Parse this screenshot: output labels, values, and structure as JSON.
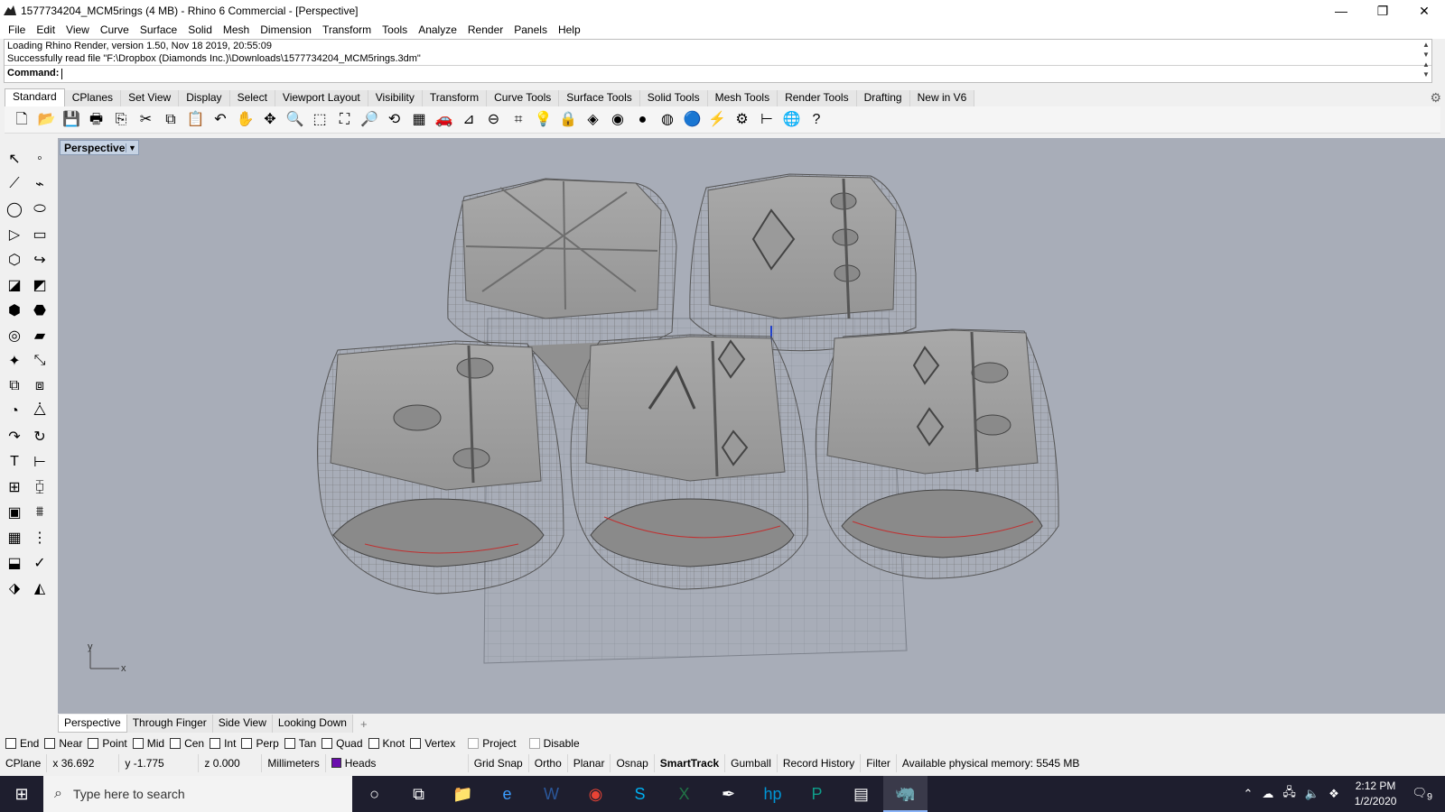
{
  "window": {
    "title": "1577734204_MCM5rings (4 MB) - Rhino 6 Commercial - [Perspective]",
    "minimize": "—",
    "restore": "❐",
    "close": "✕"
  },
  "menu": [
    "File",
    "Edit",
    "View",
    "Curve",
    "Surface",
    "Solid",
    "Mesh",
    "Dimension",
    "Transform",
    "Tools",
    "Analyze",
    "Render",
    "Panels",
    "Help"
  ],
  "command_history": [
    "Loading Rhino Render, version 1.50, Nov 18 2019, 20:55:09",
    "Successfully read file \"F:\\Dropbox (Diamonds Inc.)\\Downloads\\1577734204_MCM5rings.3dm\""
  ],
  "command_prompt": "Command:",
  "toolbar_tabs": [
    "Standard",
    "CPlanes",
    "Set View",
    "Display",
    "Select",
    "Viewport Layout",
    "Visibility",
    "Transform",
    "Curve Tools",
    "Surface Tools",
    "Solid Tools",
    "Mesh Tools",
    "Render Tools",
    "Drafting",
    "New in V6"
  ],
  "toolbar_icons": [
    {
      "icon": "new-file",
      "glyph": "🗋"
    },
    {
      "icon": "open-folder",
      "glyph": "📂"
    },
    {
      "icon": "save",
      "glyph": "💾"
    },
    {
      "icon": "print",
      "glyph": "🖶"
    },
    {
      "icon": "import",
      "glyph": "⎘"
    },
    {
      "icon": "cut",
      "glyph": "✂"
    },
    {
      "icon": "copy",
      "glyph": "⧉"
    },
    {
      "icon": "paste",
      "glyph": "📋"
    },
    {
      "icon": "undo",
      "glyph": "↶"
    },
    {
      "icon": "pan-hand",
      "glyph": "✋"
    },
    {
      "icon": "rotate-view",
      "glyph": "✥"
    },
    {
      "icon": "zoom",
      "glyph": "🔍"
    },
    {
      "icon": "zoom-window",
      "glyph": "⬚"
    },
    {
      "icon": "zoom-extents",
      "glyph": "⛶"
    },
    {
      "icon": "zoom-selected",
      "glyph": "🔎"
    },
    {
      "icon": "rotate-camera",
      "glyph": "⟲"
    },
    {
      "icon": "four-viewports",
      "glyph": "▦"
    },
    {
      "icon": "car-view",
      "glyph": "🚗"
    },
    {
      "icon": "construction-plane",
      "glyph": "⊿"
    },
    {
      "icon": "select-filter",
      "glyph": "⊖"
    },
    {
      "icon": "osnap",
      "glyph": "⌗"
    },
    {
      "icon": "light-bulb",
      "glyph": "💡"
    },
    {
      "icon": "lock",
      "glyph": "🔒"
    },
    {
      "icon": "layer",
      "glyph": "◈"
    },
    {
      "icon": "color-wheel",
      "glyph": "◉"
    },
    {
      "icon": "render-sphere",
      "glyph": "●"
    },
    {
      "icon": "material-sphere",
      "glyph": "◍"
    },
    {
      "icon": "render-blue",
      "glyph": "🔵"
    },
    {
      "icon": "drafting-lamp",
      "glyph": "⚡"
    },
    {
      "icon": "options-gear",
      "glyph": "⚙"
    },
    {
      "icon": "dimension",
      "glyph": "⊢"
    },
    {
      "icon": "globe",
      "glyph": "🌐"
    },
    {
      "icon": "help",
      "glyph": "?"
    }
  ],
  "left_tools": [
    [
      "select-arrow",
      "point"
    ],
    [
      "polyline",
      "curve-tools"
    ],
    [
      "circle",
      "ellipse"
    ],
    [
      "polygon",
      "rectangle"
    ],
    [
      "arc",
      "fillet"
    ],
    [
      "surface-corner",
      "surface-tools"
    ],
    [
      "solid-box",
      "solid-boolean"
    ],
    [
      "extrude",
      "mesh"
    ],
    [
      "transform-move",
      "scale"
    ],
    [
      "array",
      "align"
    ],
    [
      "group",
      "block"
    ],
    [
      "curve-from-object",
      "offset"
    ],
    [
      "text",
      "dimension"
    ],
    [
      "layout",
      "detail"
    ],
    [
      "render-box",
      "cage"
    ],
    [
      "grid-array",
      "analyze"
    ],
    [
      "shell",
      "check"
    ],
    [
      "paint",
      "clipping"
    ]
  ],
  "viewport": {
    "name": "Perspective",
    "axis_x": "x",
    "axis_y": "y",
    "bg_color": "#a8adb8"
  },
  "view_tabs": [
    "Perspective",
    "Through Finger",
    "Side View",
    "Looking Down"
  ],
  "osnap": [
    "End",
    "Near",
    "Point",
    "Mid",
    "Cen",
    "Int",
    "Perp",
    "Tan",
    "Quad",
    "Knot",
    "Vertex"
  ],
  "osnap_extra": [
    "Project",
    "Disable"
  ],
  "status": {
    "cplane": "CPlane",
    "x": "x 36.692",
    "y": "y -1.775",
    "z": "z 0.000",
    "units": "Millimeters",
    "layer": "Heads",
    "layer_color": "#6a0dad",
    "grid_snap": "Grid Snap",
    "ortho": "Ortho",
    "planar": "Planar",
    "osnap": "Osnap",
    "smarttrack": "SmartTrack",
    "gumball": "Gumball",
    "record_history": "Record History",
    "filter": "Filter",
    "memory": "Available physical memory: 5545 MB"
  },
  "taskbar": {
    "search_placeholder": "Type here to search",
    "apps": [
      "cortana-circle",
      "task-view",
      "file-explorer",
      "edge",
      "word",
      "chrome",
      "skype",
      "excel",
      "pen-tool",
      "hp",
      "publisher",
      "scanner",
      "rhino"
    ],
    "time": "2:12 PM",
    "date": "1/2/2020",
    "notifications": "9"
  }
}
